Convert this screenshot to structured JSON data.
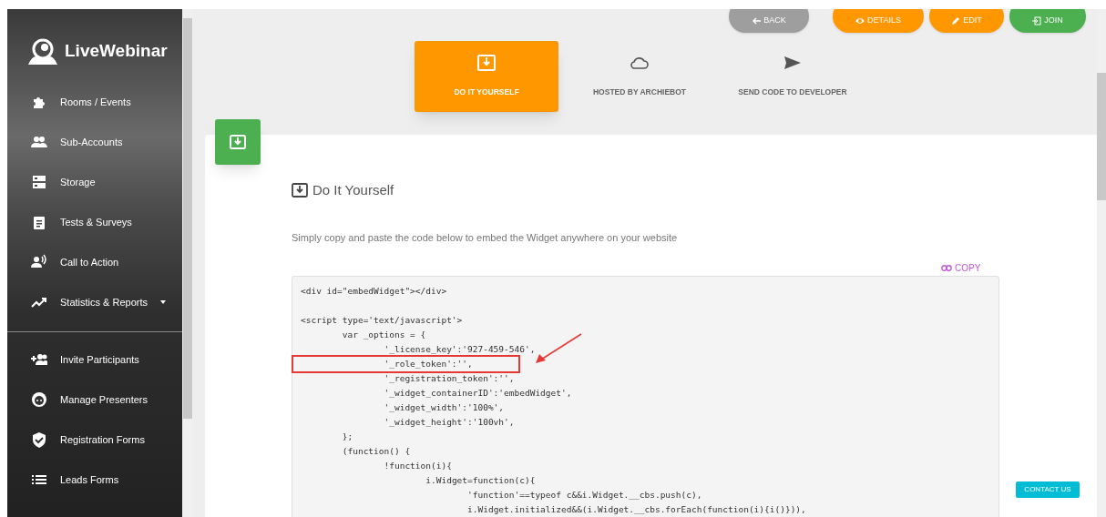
{
  "sidebar": {
    "logo": "LiveWebinar",
    "main_items": [
      {
        "label": "Rooms / Events"
      },
      {
        "label": "Sub-Accounts"
      },
      {
        "label": "Storage"
      },
      {
        "label": "Tests & Surveys"
      },
      {
        "label": "Call to Action"
      },
      {
        "label": "Statistics & Reports",
        "dropdown": true
      }
    ],
    "tool_items": [
      {
        "label": "Invite Participants"
      },
      {
        "label": "Manage Presenters"
      },
      {
        "label": "Registration Forms"
      },
      {
        "label": "Leads Forms"
      }
    ]
  },
  "top_buttons": [
    {
      "label": "BACK",
      "kind": "back"
    },
    {
      "label": "DETAILS",
      "kind": "details"
    },
    {
      "label": "EDIT",
      "kind": "edit"
    },
    {
      "label": "JOIN",
      "kind": "join"
    }
  ],
  "tabs": [
    {
      "label": "DO IT YOURSELF",
      "selected": true
    },
    {
      "label": "HOSTED BY ARCHIEBOT",
      "selected": false
    },
    {
      "label": "SEND CODE TO DEVELOPER",
      "selected": false
    }
  ],
  "panel": {
    "title": "Do It Yourself",
    "description": "Simply copy and paste the code below to embed the Widget anywhere on your website",
    "copy_label": "COPY",
    "code_blocks": [
      [
        {
          "text": "<div id=\"embedWidget\"></div>",
          "highlighted": false
        }
      ],
      [
        {
          "text": "<script type='text/javascript'>",
          "highlighted": false
        },
        {
          "text": "\tvar _options = {",
          "highlighted": false
        },
        {
          "text": "\t\t'_license_key':'927-459-546',",
          "highlighted": false
        },
        {
          "text": "\t\t'_role_token':'',",
          "highlighted": true
        },
        {
          "text": "\t\t'_registration_token':'',",
          "highlighted": false
        },
        {
          "text": "\t\t'_widget_containerID':'embedWidget',",
          "highlighted": false
        },
        {
          "text": "\t\t'_widget_width':'100%',",
          "highlighted": false
        },
        {
          "text": "\t\t'_widget_height':'100vh',",
          "highlighted": false
        },
        {
          "text": "\t};",
          "highlighted": false
        },
        {
          "text": "\t(function() {",
          "highlighted": false
        },
        {
          "text": "\t\t!function(i){",
          "highlighted": false
        },
        {
          "text": "\t\t\ti.Widget=function(c){",
          "highlighted": false
        },
        {
          "text": "\t\t\t\t'function'==typeof c&&i.Widget.__cbs.push(c),",
          "highlighted": false
        },
        {
          "text": "\t\t\t\ti.Widget.initialized&&(i.Widget.__cbs.forEach(function(i){i()})),",
          "highlighted": false
        }
      ]
    ]
  },
  "contact_button": "CONTACT US"
}
